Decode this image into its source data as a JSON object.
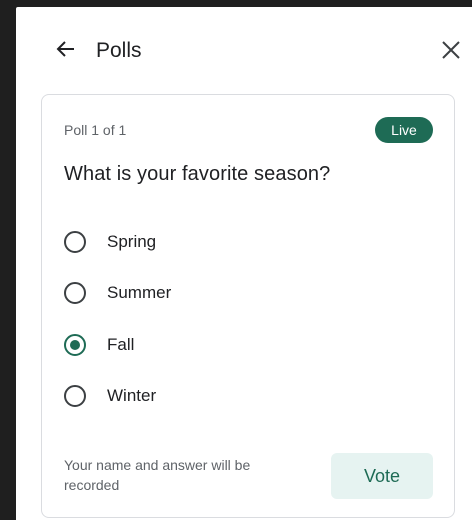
{
  "header": {
    "title": "Polls",
    "back_icon": "arrow-left-icon",
    "close_icon": "close-icon"
  },
  "poll": {
    "count_label": "Poll 1 of 1",
    "status_badge": "Live",
    "question": "What is your favorite season?",
    "options": [
      {
        "label": "Spring",
        "selected": false
      },
      {
        "label": "Summer",
        "selected": false
      },
      {
        "label": "Fall",
        "selected": true
      },
      {
        "label": "Winter",
        "selected": false
      }
    ],
    "footer_note": "Your name and answer will be recorded",
    "vote_label": "Vote"
  },
  "colors": {
    "accent": "#1e6b55",
    "vote_bg": "#e6f3f1",
    "text_primary": "#202124",
    "text_secondary": "#5f6368",
    "border": "#dadce0"
  }
}
